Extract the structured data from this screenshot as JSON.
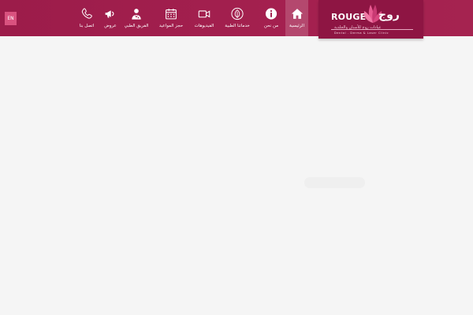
{
  "header": {
    "language_label": "EN",
    "brand": {
      "latin": "ROUGE",
      "arabic": "روج",
      "arabic_subtitle": "عيادات روج للأسنان والجلدية",
      "tagline": "Dental . Derma & Laser Clinic"
    },
    "nav": [
      {
        "label": "الرئيسية",
        "icon": "home-icon",
        "active": true
      },
      {
        "label": "من نحن",
        "icon": "info-icon",
        "active": false
      },
      {
        "label": "خدماتنا الطبية",
        "icon": "leaf-icon",
        "active": false
      },
      {
        "label": "الفيديوهات",
        "icon": "video-icon",
        "active": false
      },
      {
        "label": "حجز المواعيد",
        "icon": "calendar-icon",
        "active": false
      },
      {
        "label": "الفريق الطبي",
        "icon": "doctor-icon",
        "active": false
      },
      {
        "label": "عروض",
        "icon": "megaphone-icon",
        "active": false
      },
      {
        "label": "اتصل بنا",
        "icon": "phone-icon",
        "active": false
      }
    ]
  },
  "colors": {
    "header_bg": "#a4204f",
    "logo_bg": "#8e1543",
    "accent_pink": "#d9527f",
    "page_bg": "#f5f5f5"
  }
}
